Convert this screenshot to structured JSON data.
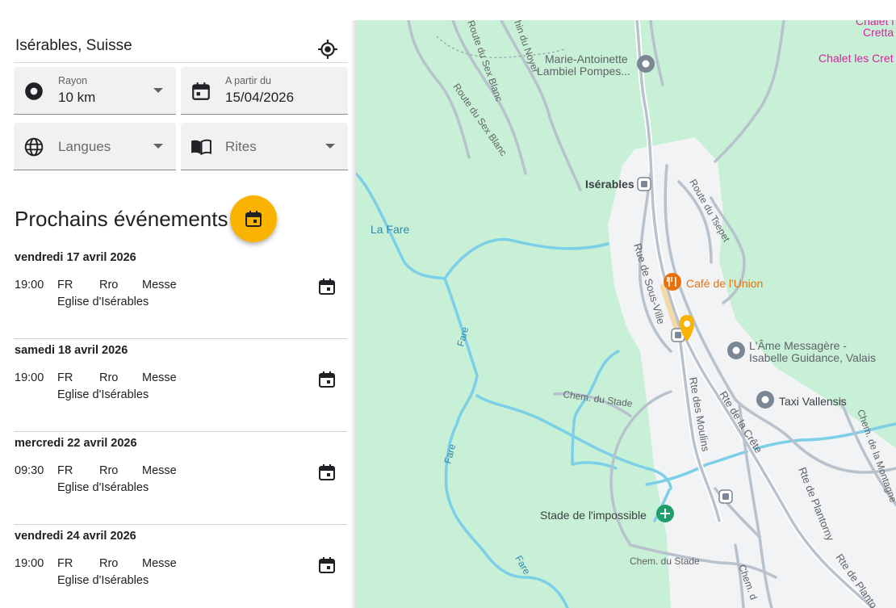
{
  "search": {
    "location": "Isérables, Suisse"
  },
  "filters": {
    "radius": {
      "label": "Rayon",
      "value": "10 km"
    },
    "start_date": {
      "label": "A partir du",
      "value": "15/04/2026"
    },
    "languages": {
      "placeholder": "Langues"
    },
    "rites": {
      "placeholder": "Rites"
    }
  },
  "events_section": {
    "title": "Prochains événements"
  },
  "events": [
    {
      "date": "vendredi 17 avril 2026",
      "time": "19:00",
      "language": "FR",
      "rite": "Rro",
      "type": "Messe",
      "church": "Eglise d'Isérables"
    },
    {
      "date": "samedi 18 avril 2026",
      "time": "19:00",
      "language": "FR",
      "rite": "Rro",
      "type": "Messe",
      "church": "Eglise d'Isérables"
    },
    {
      "date": "mercredi 22 avril 2026",
      "time": "09:30",
      "language": "FR",
      "rite": "Rro",
      "type": "Messe",
      "church": "Eglise d'Isérables"
    },
    {
      "date": "vendredi 24 avril 2026",
      "time": "19:00",
      "language": "FR",
      "rite": "Rro",
      "type": "Messe",
      "church": "Eglise d'Isérables"
    }
  ],
  "map": {
    "labels": {
      "chalet_cretta_1": "Chalet l",
      "chalet_cretta_2": "Cretta",
      "chalet_les_cret": "Chalet les Cret",
      "marie_antoinette_1": "Marie-Antoinette",
      "marie_antoinette_2": "Lambiel Pompes...",
      "route_sex_blanc_top": "Route du Sex Blanc",
      "route_sex_blanc": "Route du Sex Blanc",
      "chemin_noyer": "hin du Noyer",
      "iserables": "Isérables",
      "route_tsepet": "Route du Tsepet",
      "la_fare": "La Fare",
      "rue_sous_ville": "Rue de Sous-Ville",
      "cafe_union": "Café de l'Union",
      "ame_messagere_1": "L'Âme Messagère -",
      "ame_messagere_2": "Isabelle Guidance, Valais",
      "fare_1": "Fare",
      "fare_2": "Fare",
      "fare_3": "Fare",
      "chem_stade_1": "Chem. du Stade",
      "chem_stade_2": "Chem. du Stade",
      "rte_moulins": "Rte des Moulins",
      "rte_crete": "Rte de la Crête",
      "taxi": "Taxi Vallensis",
      "chem_montagne": "Chem. de la Montagne",
      "rte_plantorny": "Rte de Plantorny",
      "rte_plantorny_2": "Rte de Planto",
      "chem_s": "Chem. d",
      "stade_impossible": "Stade de l'impossible"
    },
    "colors": {
      "background": "#c7f0d6",
      "village": "#f1f3f4",
      "water": "#7dcfe8",
      "road": "#b8c2cc",
      "marker": "#f9b300",
      "poi_orange": "#e8710a",
      "poi_gray": "#7b8794",
      "poi_green": "#1e9e6a",
      "pink_label": "#d6249f"
    }
  }
}
